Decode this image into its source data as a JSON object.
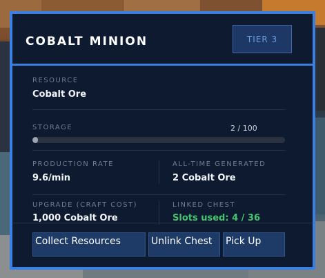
{
  "panel": {
    "title": "COBALT MINION",
    "tier_label": "TIER 3"
  },
  "resource": {
    "label": "RESOURCE",
    "value": "Cobalt Ore"
  },
  "storage": {
    "label": "STORAGE",
    "readout": "2 / 100",
    "current": 2,
    "capacity": 100
  },
  "production": {
    "label": "PRODUCTION RATE",
    "value": "9.6/min"
  },
  "generated": {
    "label": "ALL-TIME GENERATED",
    "value": "2 Cobalt Ore"
  },
  "upgrade": {
    "label": "UPGRADE (CRAFT COST)",
    "value": "1,000 Cobalt Ore"
  },
  "chest": {
    "label": "LINKED CHEST",
    "value": "Slots used: 4 / 36"
  },
  "buttons": {
    "collect": "Collect Resources",
    "unlink": "Unlink Chest",
    "pickup": "Pick Up"
  },
  "colors": {
    "accent": "#3d7fe0",
    "panel_bg": "#0e1a30",
    "button_bg": "#1e3a66",
    "success": "#43c46e"
  }
}
